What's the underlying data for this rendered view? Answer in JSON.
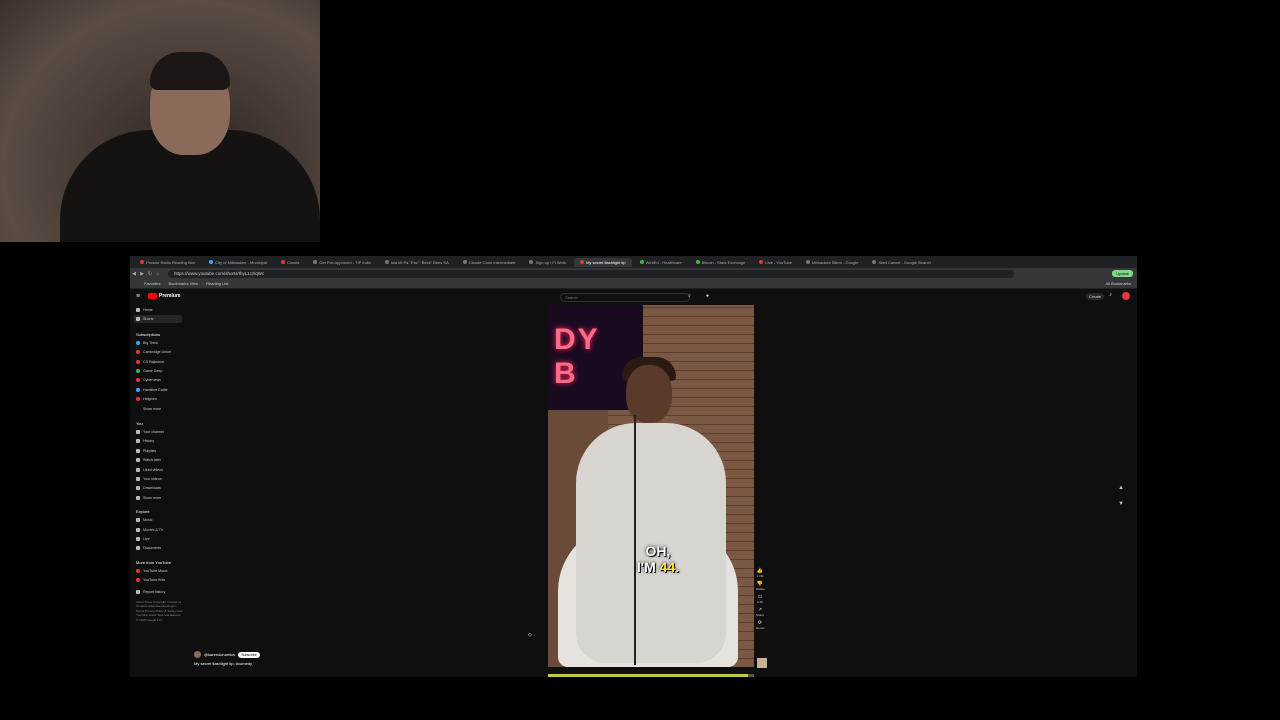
{
  "browser": {
    "tabs": [
      {
        "label": "Prosaic Radio Reading Nuc",
        "color": "#e53935"
      },
      {
        "label": "City of Milwaukee - Municipal",
        "color": "#3ea6ff"
      },
      {
        "label": "Clouds",
        "color": "#e53935"
      },
      {
        "label": "Get Pre-Approved - TIP Indic",
        "color": "#777777"
      },
      {
        "label": "Isla Mi Pa \"Paz\" \"Beck\" Bees SA",
        "color": "#777777"
      },
      {
        "label": "Claude Code Intermediate",
        "color": "#777777"
      },
      {
        "label": "Sign up / Fl Work",
        "color": "#777777"
      },
      {
        "label": "My secret flashlight tip",
        "color": "#e53935",
        "active": true
      },
      {
        "label": "WebEd - Healthcare",
        "color": "#4caf50"
      },
      {
        "label": "Bitcoin - Stark Exchange",
        "color": "#4caf50"
      },
      {
        "label": "Live - YouTube",
        "color": "#e53935"
      },
      {
        "label": "Milwaukee Bilers - Google",
        "color": "#777777"
      },
      {
        "label": "Start Cancel - Google Search",
        "color": "#777777"
      }
    ],
    "url": "https://www.youtube.com/shorts/IhyL1czlqWc",
    "update_label": "Update",
    "bookmarks": [
      "Favorites",
      "Bookmarks View",
      "Reading List"
    ],
    "all_bookmarks": "All Bookmarks"
  },
  "youtube": {
    "logo_text": "Premium",
    "search_placeholder": "Search",
    "create_label": "Create",
    "sidebar": {
      "top": [
        {
          "label": "Home",
          "icon": "home-icon"
        },
        {
          "label": "Shorts",
          "icon": "shorts-icon",
          "active": true
        }
      ],
      "subscriptions_header": "Subscriptions",
      "subscriptions": [
        {
          "label": "Big Think",
          "color": "blue"
        },
        {
          "label": "Cambridge Union",
          "color": "red"
        },
        {
          "label": "CS Rajkumar",
          "color": "red"
        },
        {
          "label": "Game Deep",
          "color": "green"
        },
        {
          "label": "Cybernews",
          "color": "red"
        },
        {
          "label": "Hamilton Cattle",
          "color": "blue"
        },
        {
          "label": "Helgiven",
          "color": "red"
        },
        {
          "label": "Show more",
          "color": "none"
        }
      ],
      "you_header": "You",
      "you_items": [
        {
          "label": "Your channel"
        },
        {
          "label": "History"
        },
        {
          "label": "Playlists"
        },
        {
          "label": "Watch later"
        },
        {
          "label": "Liked videos"
        },
        {
          "label": "Your videos"
        },
        {
          "label": "Downloads"
        },
        {
          "label": "Show more"
        }
      ],
      "explore_header": "Explore",
      "explore_items": [
        {
          "label": "Music"
        },
        {
          "label": "Movies & TV"
        },
        {
          "label": "Live"
        },
        {
          "label": "Documents"
        }
      ],
      "more_header": "More from YouTube",
      "more_items": [
        {
          "label": "YouTube Music",
          "color": "red"
        },
        {
          "label": "YouTube Kids",
          "color": "red"
        }
      ],
      "settings_label": "Report history",
      "footer1": "About Press Copyright Contact us Creators Advertise Developers",
      "footer2": "Terms Privacy Policy & Safety How YouTube works Test new features",
      "footer3": "© 2025 Google LLC"
    },
    "video": {
      "caption_line1": "OH,",
      "caption_line2_pre": "I'M ",
      "caption_highlight": "44.",
      "neon_text": "DY\nB",
      "progress": 0.97
    },
    "actions": [
      {
        "icon": "like-icon",
        "label": "1.1M"
      },
      {
        "icon": "dislike-icon",
        "label": "Dislike"
      },
      {
        "icon": "comment-icon",
        "label": "4.4K"
      },
      {
        "icon": "share-icon",
        "label": "Share"
      },
      {
        "icon": "remix-icon",
        "label": "Remix"
      }
    ],
    "channel_handle": "@karendonomics",
    "subscribe_label": "Subscribe",
    "video_title": "My secret flashlight tip. #comedy"
  }
}
